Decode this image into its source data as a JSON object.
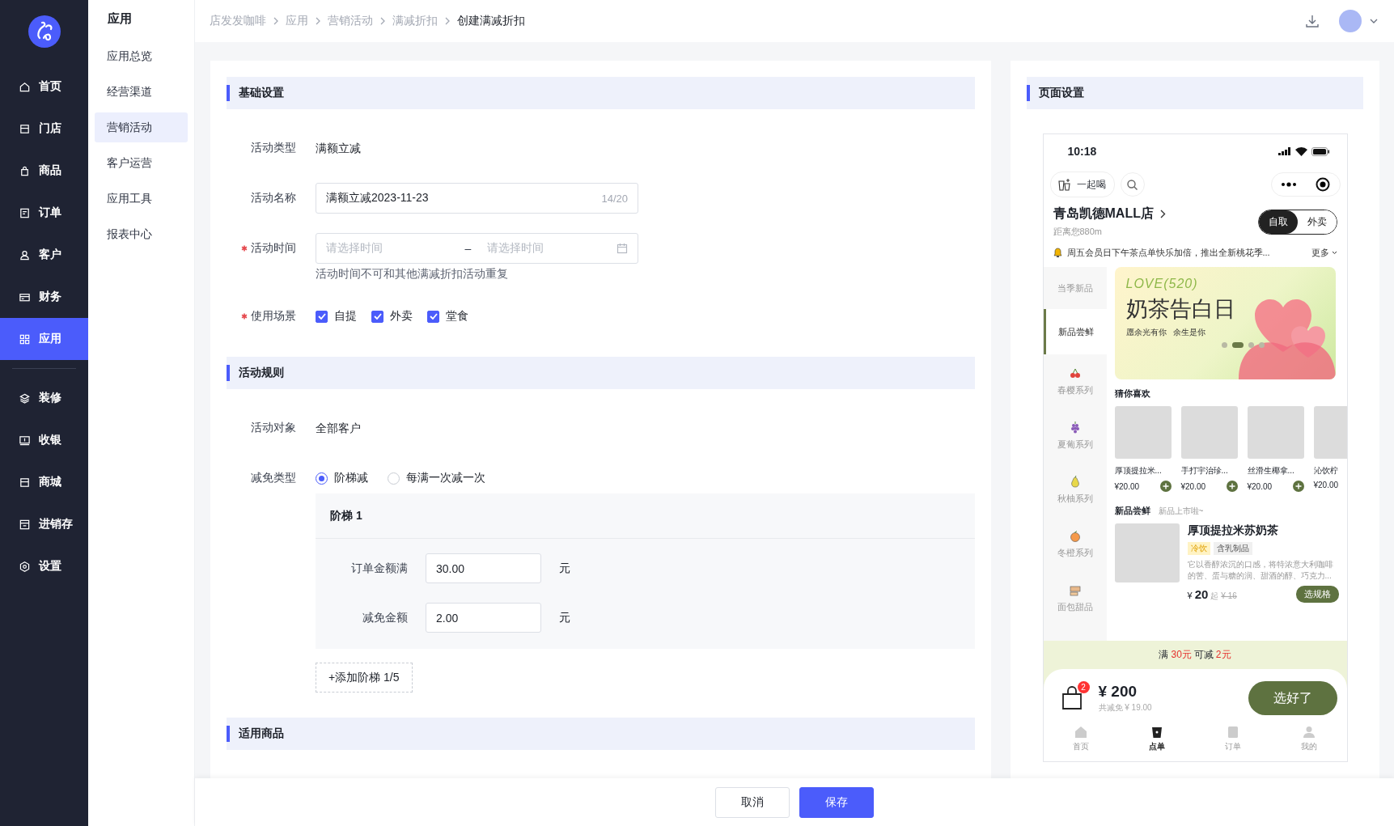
{
  "sidebar": {
    "groups": [
      [
        {
          "label": "首页",
          "selected": false
        },
        {
          "label": "门店",
          "selected": false
        },
        {
          "label": "商品",
          "selected": false
        },
        {
          "label": "订单",
          "selected": false
        },
        {
          "label": "客户",
          "selected": false
        },
        {
          "label": "财务",
          "selected": false
        },
        {
          "label": "应用",
          "selected": true
        }
      ],
      [
        {
          "label": "装修",
          "selected": false
        },
        {
          "label": "收银",
          "selected": false
        },
        {
          "label": "商城",
          "selected": false
        },
        {
          "label": "进销存",
          "selected": false
        },
        {
          "label": "设置",
          "selected": false
        }
      ]
    ]
  },
  "subnav": {
    "title": "应用",
    "items": [
      {
        "label": "应用总览",
        "selected": false
      },
      {
        "label": "经营渠道",
        "selected": false
      },
      {
        "label": "营销活动",
        "selected": true
      },
      {
        "label": "客户运营",
        "selected": false
      },
      {
        "label": "应用工具",
        "selected": false
      },
      {
        "label": "报表中心",
        "selected": false
      }
    ]
  },
  "header": {
    "breadcrumb": [
      {
        "label": "店发发咖啡",
        "current": false
      },
      {
        "label": "应用",
        "current": false
      },
      {
        "label": "营销活动",
        "current": false
      },
      {
        "label": "满减折扣",
        "current": false
      },
      {
        "label": "创建满减折扣",
        "current": true
      }
    ]
  },
  "form": {
    "sections": [
      {
        "title": "基础设置",
        "fields": [
          {
            "kind": "text",
            "label": "活动类型",
            "required": false,
            "value": "满额立减"
          },
          {
            "kind": "input",
            "label": "活动名称",
            "required": false,
            "value": "满额立减2023-11-23",
            "counter": "14/20"
          },
          {
            "kind": "daterange",
            "label": "活动时间",
            "required": true,
            "start_placeholder": "请选择时间",
            "separator": "–",
            "end_placeholder": "请选择时间",
            "hint": "活动时间不可和其他满减折扣活动重复"
          },
          {
            "kind": "checkboxes",
            "label": "使用场景",
            "required": true,
            "options": [
              {
                "label": "自提",
                "checked": true
              },
              {
                "label": "外卖",
                "checked": true
              },
              {
                "label": "堂食",
                "checked": true
              }
            ]
          }
        ]
      },
      {
        "title": "活动规则",
        "fields": [
          {
            "kind": "text",
            "label": "活动对象",
            "required": false,
            "value": "全部客户"
          },
          {
            "kind": "radios",
            "label": "减免类型",
            "required": false,
            "options": [
              {
                "label": "阶梯减",
                "selected": true
              },
              {
                "label": "每满一次减一次",
                "selected": false
              }
            ]
          }
        ],
        "tiers": {
          "items": [
            {
              "title": "阶梯 1",
              "rows": [
                {
                  "label": "订单金额满",
                  "value": "30.00",
                  "unit": "元"
                },
                {
                  "label": "减免金额",
                  "value": "2.00",
                  "unit": "元"
                }
              ]
            }
          ],
          "add_button": "+添加阶梯 1/5"
        }
      },
      {
        "title": "适用商品"
      }
    ]
  },
  "footer": {
    "buttons": [
      {
        "label": "取消",
        "kind": "default"
      },
      {
        "label": "保存",
        "kind": "primary"
      }
    ]
  },
  "preview": {
    "title": "页面设置",
    "phone": {
      "time": "10:18",
      "capsule_label": "一起喝",
      "store_name": "青岛凯德MALL店",
      "distance": "距离您880m",
      "modes": [
        {
          "label": "自取",
          "selected": true
        },
        {
          "label": "外卖",
          "selected": false
        }
      ],
      "notice": "周五会员日下午茶点单快乐加倍，推出全新桃花季...",
      "notice_more": "更多",
      "categories": [
        {
          "label": "当季新品",
          "selected": false
        },
        {
          "label": "新品尝鲜",
          "selected": true
        },
        {
          "label": "春樱系列",
          "selected": false
        },
        {
          "label": "夏葡系列",
          "selected": false
        },
        {
          "label": "秋柚系列",
          "selected": false
        },
        {
          "label": "冬橙系列",
          "selected": false
        },
        {
          "label": "面包甜品",
          "selected": false
        }
      ],
      "banner": {
        "eyebrow": "LOVE(520)",
        "headline": "奶茶告白日",
        "taglines": [
          "愿余光有你",
          "余生是你"
        ],
        "dots": [
          {
            "selected": false
          },
          {
            "selected": true
          },
          {
            "selected": false
          },
          {
            "selected": false
          }
        ]
      },
      "recommend": {
        "title": "猜你喜欢",
        "products": [
          {
            "name": "厚顶提拉米...",
            "price": "¥20.00",
            "add_button": true
          },
          {
            "name": "手打宇治珍...",
            "price": "¥20.00",
            "add_button": true
          },
          {
            "name": "丝滑生椰拿...",
            "price": "¥20.00",
            "add_button": true
          },
          {
            "name": "沁饮柠",
            "price": "¥20.00",
            "add_button": false
          }
        ]
      },
      "new_section": {
        "title": "新品尝鲜",
        "subtitle": "新品上市啦~"
      },
      "featured": {
        "name": "厚顶提拉米苏奶茶",
        "tags": [
          {
            "label": "冷饮",
            "highlight": true
          },
          {
            "label": "含乳制品",
            "highlight": false
          }
        ],
        "description": "它以香醇浓沉的口感，将特浓意大利咖啡的苦、蛋与糖的润、甜酒的醇、巧克力...",
        "price_symbol": "¥",
        "price": "20",
        "price_suffix": "起",
        "original_price": "¥ 16",
        "button": "选规格"
      },
      "promo": [
        {
          "text": "满",
          "highlight": false
        },
        {
          "text": "30元",
          "highlight": true
        },
        {
          "text": "可减",
          "highlight": false
        },
        {
          "text": "2元",
          "highlight": true
        }
      ],
      "cart": {
        "badge": "2",
        "total": "¥ 200",
        "saved": "共减免 ¥ 19.00",
        "button": "选好了"
      },
      "tabs": [
        {
          "label": "首页",
          "selected": false
        },
        {
          "label": "点单",
          "selected": true
        },
        {
          "label": "订单",
          "selected": false
        },
        {
          "label": "我的",
          "selected": false
        }
      ]
    }
  }
}
